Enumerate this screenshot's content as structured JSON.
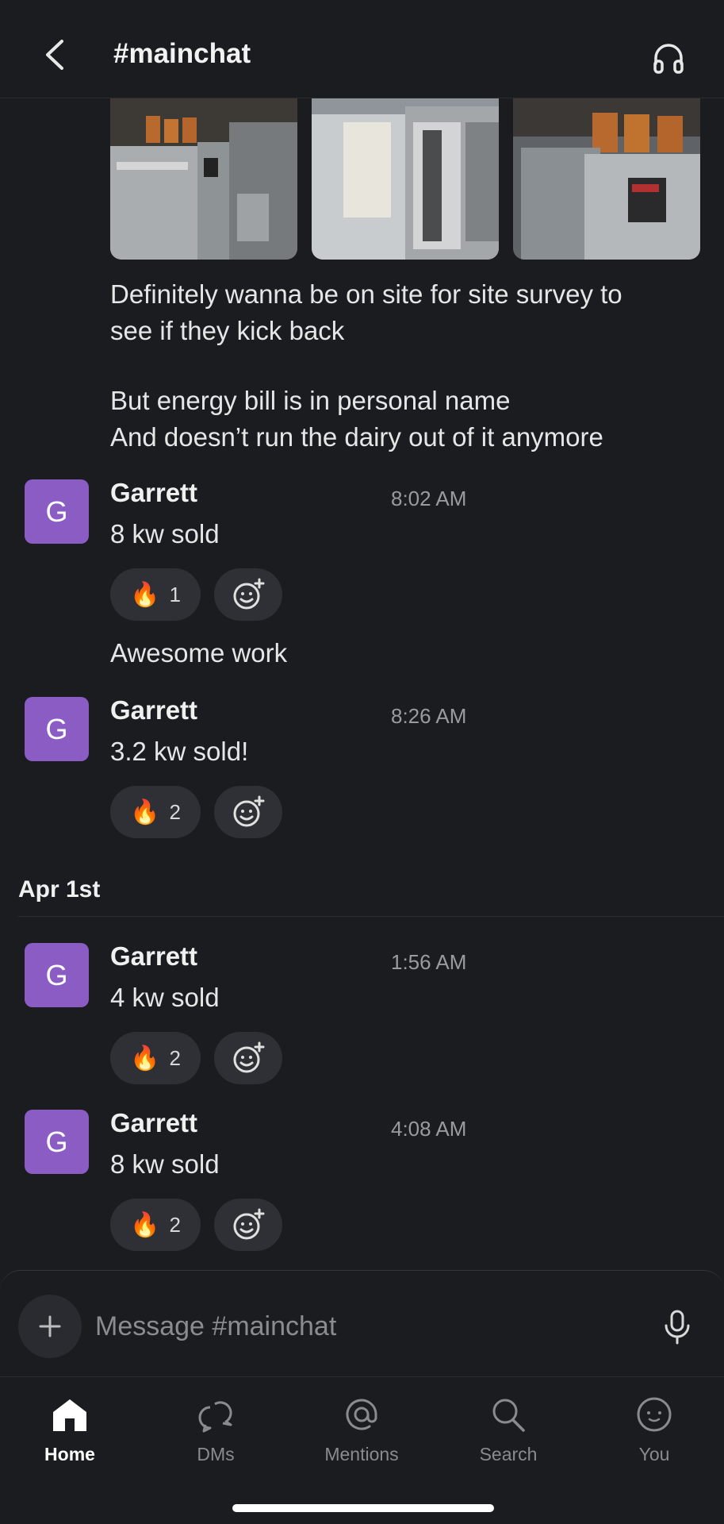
{
  "header": {
    "channel_title": "#mainchat"
  },
  "feed": {
    "prev_message_text": [
      "Definitely wanna be on site for site survey to",
      "see if they kick back",
      "But energy bill is in personal name",
      "And doesn’t run the dairy out of it anymore"
    ],
    "messages": [
      {
        "avatar": "G",
        "author": "Garrett",
        "time": "8:02 AM",
        "text": "8 kw sold",
        "reaction_emoji": "🔥",
        "reaction_count": "1"
      },
      {
        "text": "Awesome work"
      },
      {
        "avatar": "G",
        "author": "Garrett",
        "time": "8:26 AM",
        "text": "3.2 kw sold!",
        "reaction_emoji": "🔥",
        "reaction_count": "2"
      },
      {
        "avatar": "G",
        "author": "Garrett",
        "time": "1:56 AM",
        "text": "4 kw sold",
        "reaction_emoji": "🔥",
        "reaction_count": "2"
      },
      {
        "avatar": "G",
        "author": "Garrett",
        "time": "4:08 AM",
        "text": "8 kw sold",
        "reaction_emoji": "🔥",
        "reaction_count": "2"
      }
    ],
    "date_divider": "Apr 1st"
  },
  "composer": {
    "placeholder": "Message #mainchat"
  },
  "tabbar": {
    "tabs": [
      {
        "label": "Home",
        "icon": "home-icon"
      },
      {
        "label": "DMs",
        "icon": "dms-icon"
      },
      {
        "label": "Mentions",
        "icon": "at-icon"
      },
      {
        "label": "Search",
        "icon": "search-icon"
      },
      {
        "label": "You",
        "icon": "you-icon"
      }
    ]
  },
  "colors": {
    "background": "#1b1c20",
    "avatar": "#8b5cc4",
    "pill": "#2e3035",
    "muted_text": "#9a9b9f"
  }
}
